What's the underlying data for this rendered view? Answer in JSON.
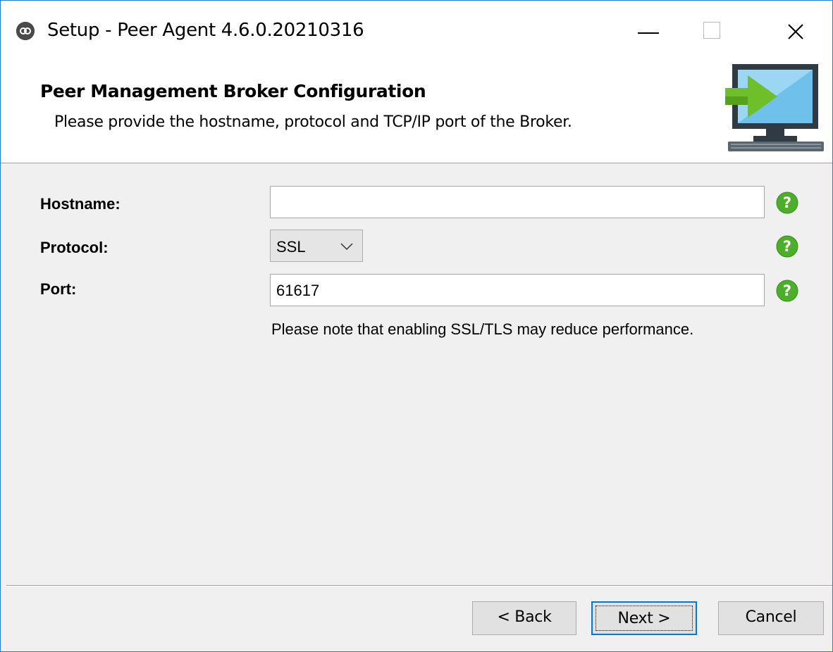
{
  "window": {
    "title": "Setup - Peer Agent 4.6.0.20210316",
    "icons": {
      "app": "peer-logo-icon",
      "minimize": "minimize-icon",
      "maximize": "maximize-icon",
      "close": "close-icon"
    }
  },
  "header": {
    "title": "Peer Management Broker Configuration",
    "subtitle": "Please provide the hostname, protocol and TCP/IP port of the Broker.",
    "icon": "monitor-arrow-icon"
  },
  "form": {
    "hostname": {
      "label": "Hostname:",
      "value": ""
    },
    "protocol": {
      "label": "Protocol:",
      "value": "SSL"
    },
    "port": {
      "label": "Port:",
      "value": "61617"
    },
    "note": "Please note that enabling SSL/TLS may reduce performance.",
    "help_icon": "help-question-icon",
    "help_color": "#4caf2a"
  },
  "buttons": {
    "back": "< Back",
    "next": "Next >",
    "cancel": "Cancel"
  },
  "colors": {
    "accent": "#0078d7",
    "border": "#2b79d0"
  }
}
